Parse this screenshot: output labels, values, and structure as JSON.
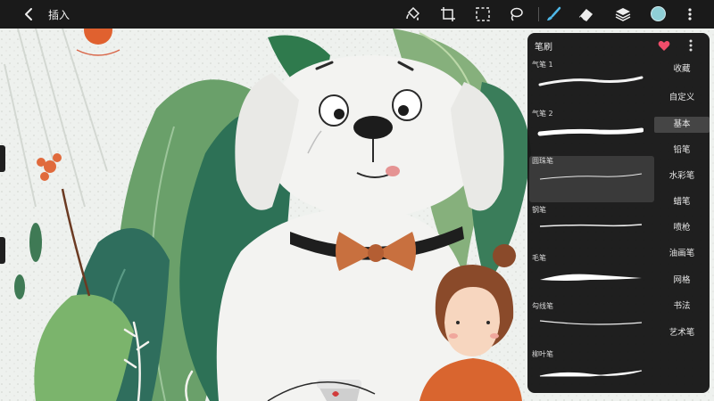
{
  "toolbar": {
    "back_icon": "chevron-left-icon",
    "title": "插入",
    "tools": [
      "paint-bucket-icon",
      "transform-icon",
      "selection-icon",
      "lasso-icon",
      "brush-icon",
      "eraser-icon",
      "layers-icon",
      "color-icon",
      "more-icon"
    ],
    "current_color": "#8fcfd6",
    "active_tool_color": "#4fb8e8"
  },
  "panel": {
    "title": "笔刷",
    "brushes": [
      {
        "name": "气笔 1"
      },
      {
        "name": "气笔 2"
      },
      {
        "name": "圆珠笔"
      },
      {
        "name": "钢笔"
      },
      {
        "name": "毛笔"
      },
      {
        "name": "勾线笔"
      },
      {
        "name": "柳叶笔"
      }
    ],
    "categories": [
      "收藏",
      "自定义",
      "基本",
      "铅笔",
      "水彩笔",
      "蜡笔",
      "喷枪",
      "油画笔",
      "网格",
      "书法",
      "艺术笔"
    ],
    "active_category": "基本",
    "active_brush": "圆珠笔",
    "heart_color": "#ef4d6a"
  }
}
